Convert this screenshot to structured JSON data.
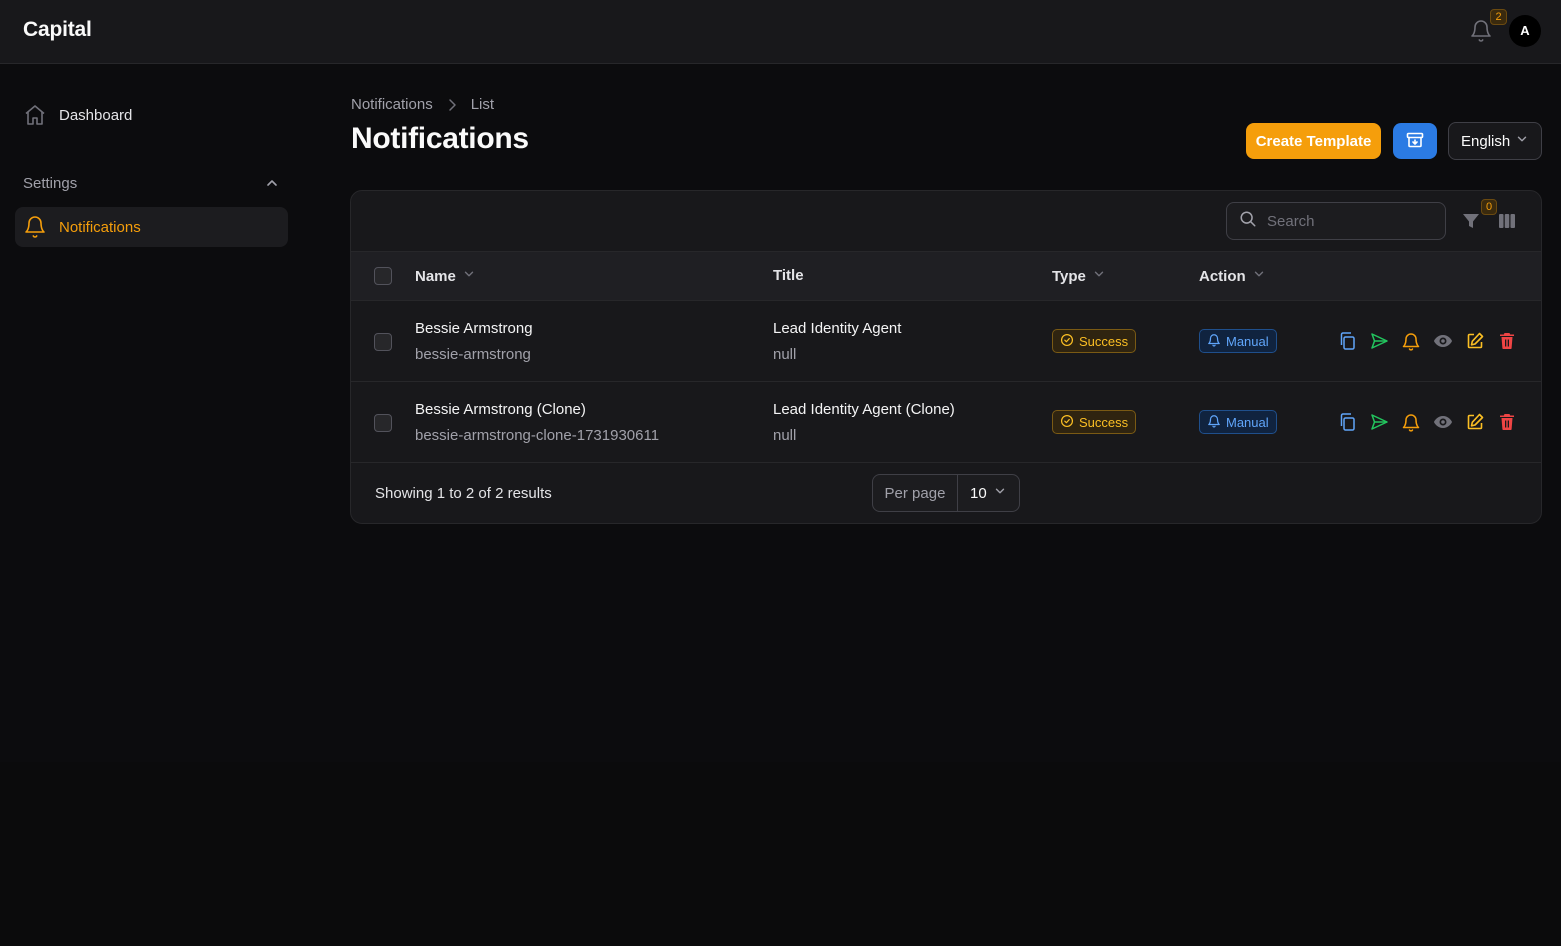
{
  "app": {
    "brand": "Capital",
    "notification_count": "2",
    "avatar_initial": "A"
  },
  "sidebar": {
    "dashboard_label": "Dashboard",
    "group_label": "Settings",
    "notifications_label": "Notifications"
  },
  "breadcrumb": {
    "parent": "Notifications",
    "current": "List"
  },
  "page": {
    "title": "Notifications"
  },
  "actions": {
    "create_label": "Create Template",
    "language": "English"
  },
  "colors": {
    "accent": "#f59e0b",
    "primary_blue": "#2b7be4",
    "success": "#fbbf24",
    "manual": "#60a5fa",
    "danger": "#ef4444",
    "send": "#22c55e"
  },
  "table": {
    "search_placeholder": "Search",
    "filter_count": "0",
    "columns": {
      "name": "Name",
      "title": "Title",
      "type": "Type",
      "action": "Action"
    },
    "rows": [
      {
        "name": "Bessie Armstrong",
        "slug": "bessie-armstrong",
        "title": "Lead Identity Agent",
        "subtitle": "null",
        "type": "Success",
        "action": "Manual"
      },
      {
        "name": "Bessie Armstrong (Clone)",
        "slug": "bessie-armstrong-clone-1731930611",
        "title": "Lead Identity Agent (Clone)",
        "subtitle": "null",
        "type": "Success",
        "action": "Manual"
      }
    ],
    "row_icons": [
      "copy-icon",
      "send-icon",
      "bell-icon",
      "eye-icon",
      "edit-icon",
      "trash-icon"
    ],
    "footer": {
      "summary": "Showing 1 to 2 of 2 results",
      "per_page_label": "Per page",
      "per_page_value": "10"
    }
  }
}
